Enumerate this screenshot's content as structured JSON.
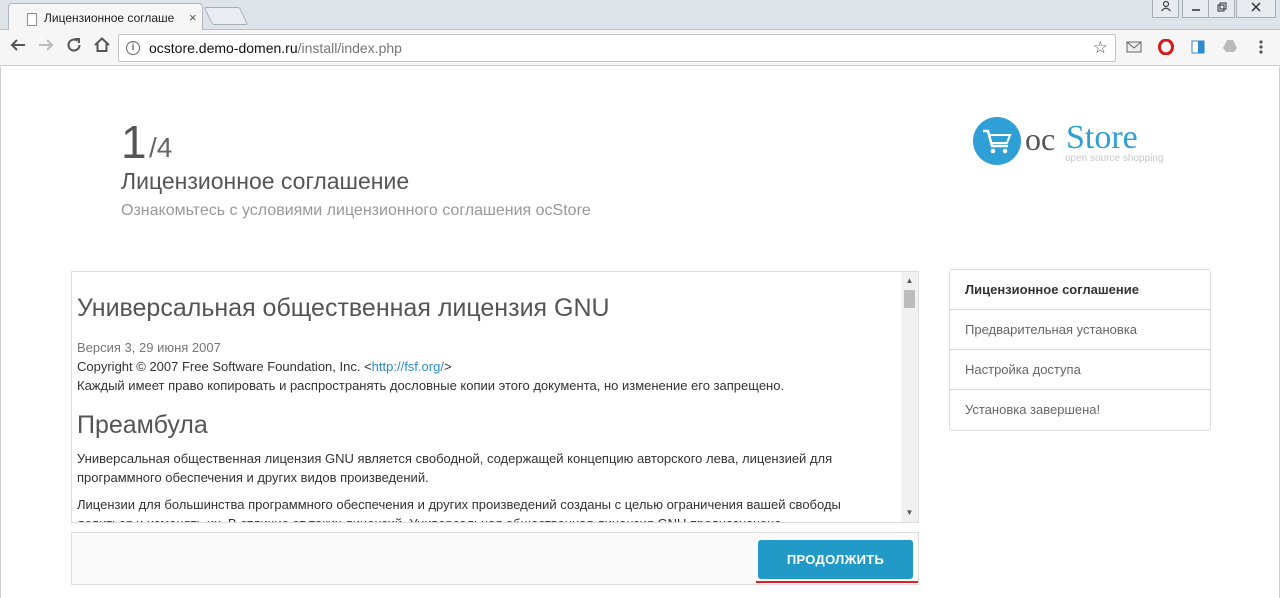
{
  "browser": {
    "tab_title": "Лицензионное соглаше",
    "tab_close": "×",
    "url_host": "ocstore.demo-domen.ru",
    "url_path": "/install/index.php",
    "window_controls": [
      "person-icon",
      "minimize-icon",
      "restore-icon",
      "close-icon"
    ]
  },
  "header": {
    "step_current": "1",
    "step_total": "/4",
    "title": "Лицензионное соглашение",
    "subtitle": "Ознакомьтесь с условиями лицензионного соглашения ocStore"
  },
  "logo": {
    "oc": "oc",
    "store": "Store",
    "tagline": "open source shopping"
  },
  "license": {
    "heading": "Универсальная общественная лицензия GNU",
    "version": "Версия 3, 29 июня 2007",
    "copyright_prefix": "Copyright © 2007 Free Software Foundation, Inc. <",
    "copyright_link": "http://fsf.org/",
    "copyright_suffix": ">",
    "notice": "Каждый имеет право копировать и распространять дословные копии этого документа, но изменение его запрещено.",
    "preamble_heading": "Преамбула",
    "paragraph1": "Универсальная общественная лицензия GNU является свободной, содержащей концепцию авторского лева, лицензией для программного обеспечения и других видов произведений.",
    "paragraph2": "Лицензии для большинства программного обеспечения и других произведений созданы с целью ограничения вашей свободы делиться и изменять их. В отличие от таких лицензий, Универсальная общественная лицензия GNU предназначена"
  },
  "actions": {
    "continue_label": "ПРОДОЛЖИТЬ"
  },
  "steps": [
    {
      "label": "Лицензионное соглашение",
      "active": true
    },
    {
      "label": "Предварительная установка",
      "active": false
    },
    {
      "label": "Настройка доступа",
      "active": false
    },
    {
      "label": "Установка завершена!",
      "active": false
    }
  ],
  "colors": {
    "accent": "#229ac8",
    "highlight_underline": "#e02020"
  }
}
